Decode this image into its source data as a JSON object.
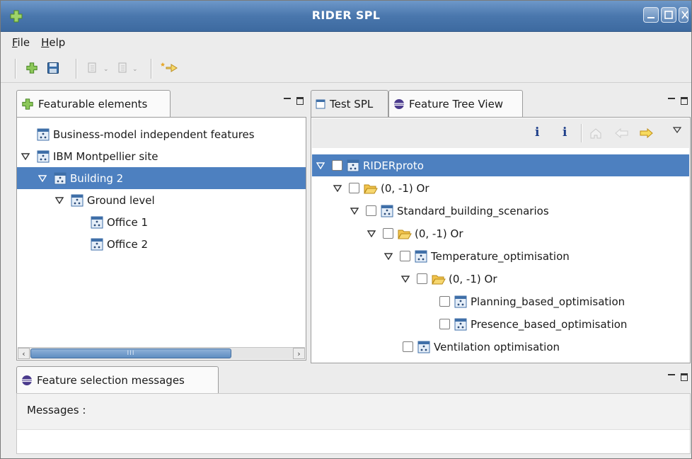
{
  "window": {
    "title": "RIDER SPL"
  },
  "menubar": {
    "items": [
      {
        "mnemonic": "F",
        "rest": "ile"
      },
      {
        "mnemonic": "H",
        "rest": "elp"
      }
    ]
  },
  "left_panel": {
    "tab_label": "Featurable elements",
    "tree": [
      {
        "label": "Business-model independent features"
      },
      {
        "label": "IBM Montpellier site"
      },
      {
        "label": "Building 2"
      },
      {
        "label": "Ground level"
      },
      {
        "label": "Office 1"
      },
      {
        "label": "Office 2"
      }
    ],
    "scroll_thumb_label": "III"
  },
  "right_panel": {
    "tabs": [
      {
        "label": "Test SPL"
      },
      {
        "label": "Feature Tree View"
      }
    ],
    "tree": [
      {
        "label": "RIDERproto"
      },
      {
        "label": "(0, -1) Or"
      },
      {
        "label": "Standard_building_scenarios"
      },
      {
        "label": "(0, -1) Or"
      },
      {
        "label": "Temperature_optimisation"
      },
      {
        "label": "(0, -1) Or"
      },
      {
        "label": "Planning_based_optimisation"
      },
      {
        "label": "Presence_based_optimisation"
      },
      {
        "label": "Ventilation optimisation"
      }
    ],
    "toolbar": {
      "info1": "i",
      "info2": "i"
    }
  },
  "bottom_panel": {
    "tab_label": "Feature selection messages",
    "messages_label": "Messages :"
  },
  "colors": {
    "selection": "#4d80c0",
    "titlebar": "#4a77ad"
  }
}
